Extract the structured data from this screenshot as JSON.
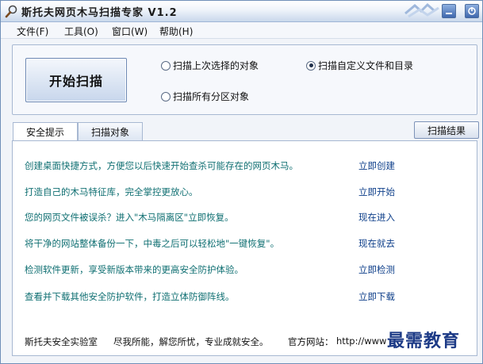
{
  "window": {
    "title": "斯托夫网页木马扫描专家 V1.2"
  },
  "menu": [
    "文件(F)",
    "工具(O)",
    "窗口(W)",
    "帮助(H)"
  ],
  "scan": {
    "start_button": "开始扫描",
    "options": [
      {
        "label": "扫描上次选择的对象",
        "selected": false
      },
      {
        "label": "扫描自定义文件和目录",
        "selected": true
      },
      {
        "label": "扫描所有分区对象",
        "selected": false
      }
    ]
  },
  "tabs": [
    {
      "label": "安全提示",
      "active": true
    },
    {
      "label": "扫描对象",
      "active": false
    }
  ],
  "results_button": "扫描结果",
  "tips": [
    {
      "text": "创建桌面快捷方式，方便您以后快速开始查杀可能存在的网页木马。",
      "action": "立即创建"
    },
    {
      "text": "打造自己的木马特征库，完全掌控更放心。",
      "action": "立即开始"
    },
    {
      "text": "您的网页文件被误杀？进入\"木马隔离区\"立即恢复。",
      "action": "现在进入"
    },
    {
      "text": "将干净的网站整体备份一下，中毒之后可以轻松地\"一键恢复\"。",
      "action": "现在就去"
    },
    {
      "text": "检测软件更新，享受新版本带来的更高安全防护体验。",
      "action": "立即检测"
    },
    {
      "text": "查看并下载其他安全防护软件，打造立体防御阵线。",
      "action": "立即下载"
    }
  ],
  "footer": {
    "lab": "斯托夫安全实验室",
    "slogan": "尽我所能，解您所忧，专业成就安全。",
    "website_label": "官方网站：",
    "website_url": "http://www"
  },
  "watermark": "最需教育",
  "colors": {
    "tip_text": "#0f6f72",
    "action_link": "#0e3f8a",
    "title_bar": "#c9d8ec"
  }
}
